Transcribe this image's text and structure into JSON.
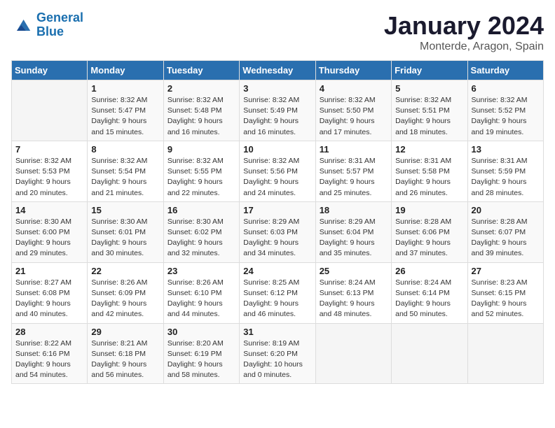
{
  "header": {
    "logo_general": "General",
    "logo_blue": "Blue",
    "title": "January 2024",
    "subtitle": "Monterde, Aragon, Spain"
  },
  "weekdays": [
    "Sunday",
    "Monday",
    "Tuesday",
    "Wednesday",
    "Thursday",
    "Friday",
    "Saturday"
  ],
  "weeks": [
    [
      {
        "num": "",
        "info": ""
      },
      {
        "num": "1",
        "info": "Sunrise: 8:32 AM\nSunset: 5:47 PM\nDaylight: 9 hours\nand 15 minutes."
      },
      {
        "num": "2",
        "info": "Sunrise: 8:32 AM\nSunset: 5:48 PM\nDaylight: 9 hours\nand 16 minutes."
      },
      {
        "num": "3",
        "info": "Sunrise: 8:32 AM\nSunset: 5:49 PM\nDaylight: 9 hours\nand 16 minutes."
      },
      {
        "num": "4",
        "info": "Sunrise: 8:32 AM\nSunset: 5:50 PM\nDaylight: 9 hours\nand 17 minutes."
      },
      {
        "num": "5",
        "info": "Sunrise: 8:32 AM\nSunset: 5:51 PM\nDaylight: 9 hours\nand 18 minutes."
      },
      {
        "num": "6",
        "info": "Sunrise: 8:32 AM\nSunset: 5:52 PM\nDaylight: 9 hours\nand 19 minutes."
      }
    ],
    [
      {
        "num": "7",
        "info": "Sunrise: 8:32 AM\nSunset: 5:53 PM\nDaylight: 9 hours\nand 20 minutes."
      },
      {
        "num": "8",
        "info": "Sunrise: 8:32 AM\nSunset: 5:54 PM\nDaylight: 9 hours\nand 21 minutes."
      },
      {
        "num": "9",
        "info": "Sunrise: 8:32 AM\nSunset: 5:55 PM\nDaylight: 9 hours\nand 22 minutes."
      },
      {
        "num": "10",
        "info": "Sunrise: 8:32 AM\nSunset: 5:56 PM\nDaylight: 9 hours\nand 24 minutes."
      },
      {
        "num": "11",
        "info": "Sunrise: 8:31 AM\nSunset: 5:57 PM\nDaylight: 9 hours\nand 25 minutes."
      },
      {
        "num": "12",
        "info": "Sunrise: 8:31 AM\nSunset: 5:58 PM\nDaylight: 9 hours\nand 26 minutes."
      },
      {
        "num": "13",
        "info": "Sunrise: 8:31 AM\nSunset: 5:59 PM\nDaylight: 9 hours\nand 28 minutes."
      }
    ],
    [
      {
        "num": "14",
        "info": "Sunrise: 8:30 AM\nSunset: 6:00 PM\nDaylight: 9 hours\nand 29 minutes."
      },
      {
        "num": "15",
        "info": "Sunrise: 8:30 AM\nSunset: 6:01 PM\nDaylight: 9 hours\nand 30 minutes."
      },
      {
        "num": "16",
        "info": "Sunrise: 8:30 AM\nSunset: 6:02 PM\nDaylight: 9 hours\nand 32 minutes."
      },
      {
        "num": "17",
        "info": "Sunrise: 8:29 AM\nSunset: 6:03 PM\nDaylight: 9 hours\nand 34 minutes."
      },
      {
        "num": "18",
        "info": "Sunrise: 8:29 AM\nSunset: 6:04 PM\nDaylight: 9 hours\nand 35 minutes."
      },
      {
        "num": "19",
        "info": "Sunrise: 8:28 AM\nSunset: 6:06 PM\nDaylight: 9 hours\nand 37 minutes."
      },
      {
        "num": "20",
        "info": "Sunrise: 8:28 AM\nSunset: 6:07 PM\nDaylight: 9 hours\nand 39 minutes."
      }
    ],
    [
      {
        "num": "21",
        "info": "Sunrise: 8:27 AM\nSunset: 6:08 PM\nDaylight: 9 hours\nand 40 minutes."
      },
      {
        "num": "22",
        "info": "Sunrise: 8:26 AM\nSunset: 6:09 PM\nDaylight: 9 hours\nand 42 minutes."
      },
      {
        "num": "23",
        "info": "Sunrise: 8:26 AM\nSunset: 6:10 PM\nDaylight: 9 hours\nand 44 minutes."
      },
      {
        "num": "24",
        "info": "Sunrise: 8:25 AM\nSunset: 6:12 PM\nDaylight: 9 hours\nand 46 minutes."
      },
      {
        "num": "25",
        "info": "Sunrise: 8:24 AM\nSunset: 6:13 PM\nDaylight: 9 hours\nand 48 minutes."
      },
      {
        "num": "26",
        "info": "Sunrise: 8:24 AM\nSunset: 6:14 PM\nDaylight: 9 hours\nand 50 minutes."
      },
      {
        "num": "27",
        "info": "Sunrise: 8:23 AM\nSunset: 6:15 PM\nDaylight: 9 hours\nand 52 minutes."
      }
    ],
    [
      {
        "num": "28",
        "info": "Sunrise: 8:22 AM\nSunset: 6:16 PM\nDaylight: 9 hours\nand 54 minutes."
      },
      {
        "num": "29",
        "info": "Sunrise: 8:21 AM\nSunset: 6:18 PM\nDaylight: 9 hours\nand 56 minutes."
      },
      {
        "num": "30",
        "info": "Sunrise: 8:20 AM\nSunset: 6:19 PM\nDaylight: 9 hours\nand 58 minutes."
      },
      {
        "num": "31",
        "info": "Sunrise: 8:19 AM\nSunset: 6:20 PM\nDaylight: 10 hours\nand 0 minutes."
      },
      {
        "num": "",
        "info": ""
      },
      {
        "num": "",
        "info": ""
      },
      {
        "num": "",
        "info": ""
      }
    ]
  ]
}
